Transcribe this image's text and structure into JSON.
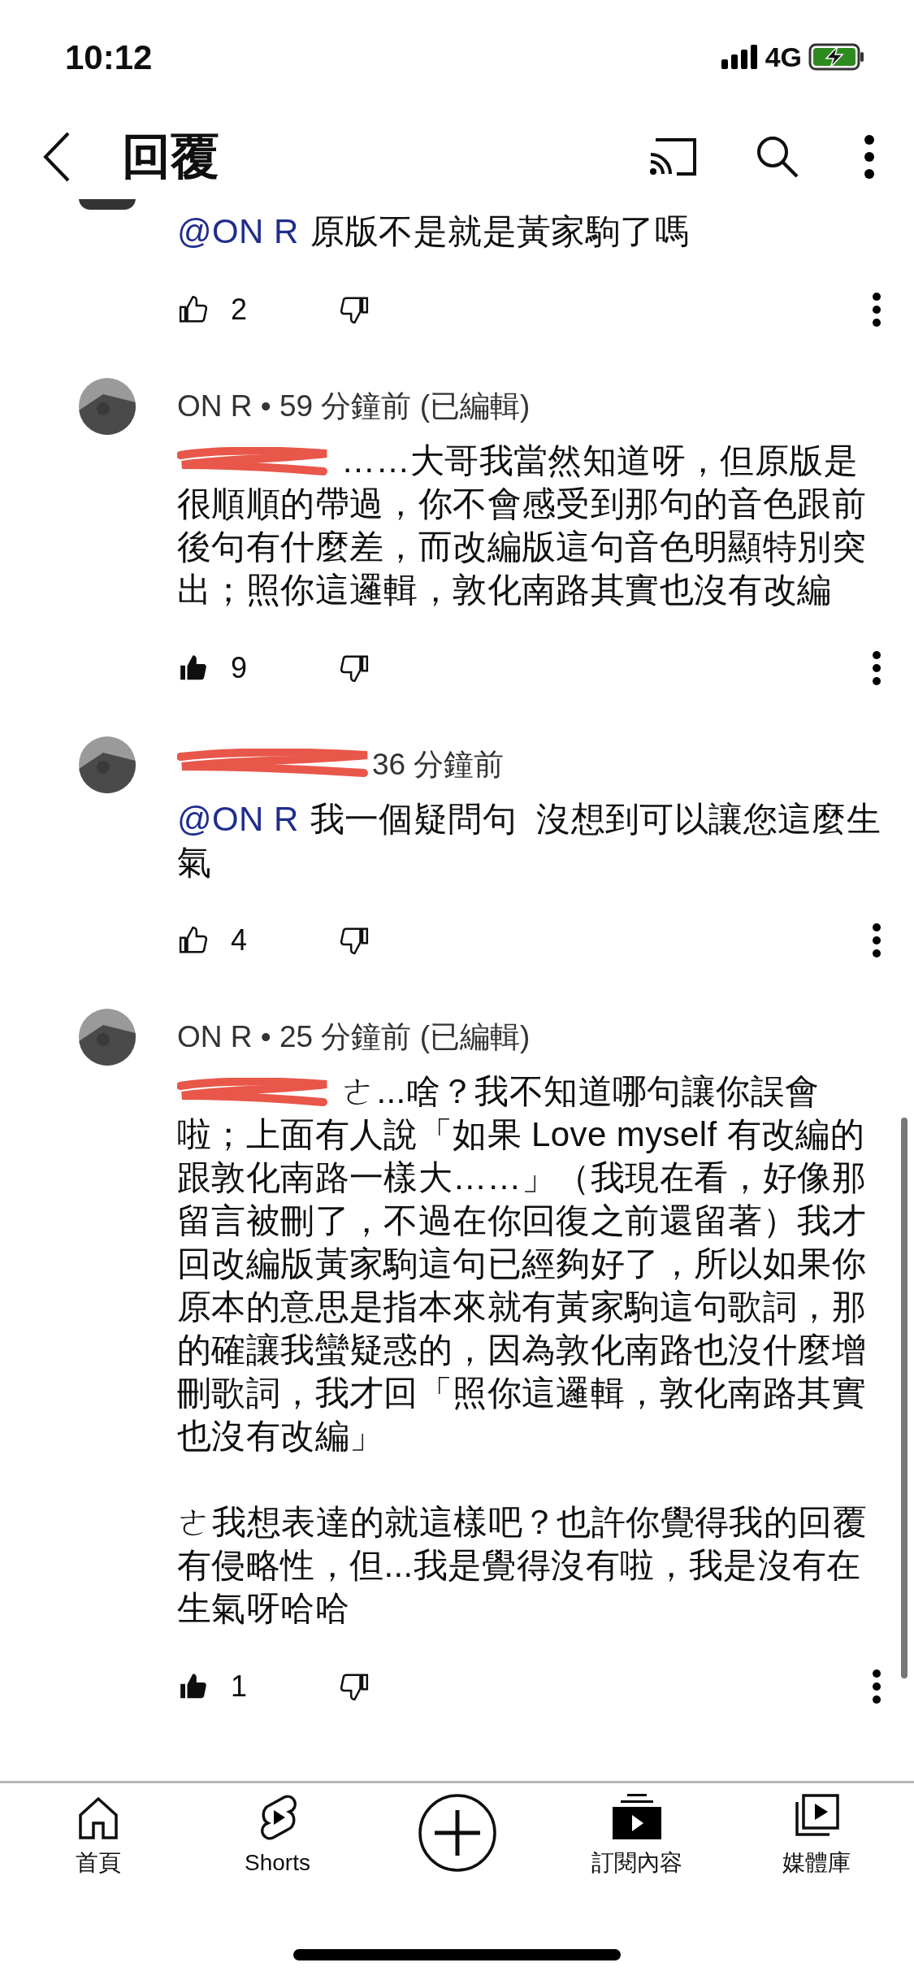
{
  "status_bar": {
    "time": "10:12",
    "network": "4G"
  },
  "header": {
    "title": "回覆"
  },
  "comments": [
    {
      "avatar_clipped": true,
      "mention": "@ON R",
      "paragraphs": [
        "原版不是就是黃家駒了嗎"
      ],
      "likes": "2",
      "liked": false
    },
    {
      "meta": "ON R • 59 分鐘前 (已編輯)",
      "mention_redacted": true,
      "paragraphs": [
        "……大哥我當然知道呀，但原版是很順順的帶過，你不會感受到那句的音色跟前後句有什麼差，而改編版這句音色明顯特別突出；照你這邏輯，敦化南路其實也沒有改編"
      ],
      "likes": "9",
      "liked": true
    },
    {
      "author_redacted": true,
      "meta": "36 分鐘前",
      "mention": "@ON R",
      "paragraphs": [
        "我一個疑問句  沒想到可以讓您這麼生氣"
      ],
      "likes": "4",
      "liked": false
    },
    {
      "meta": "ON R • 25 分鐘前 (已編輯)",
      "mention_redacted": true,
      "paragraphs": [
        "ㄜ...啥？我不知道哪句讓你誤會啦；上面有人說「如果 Love myself 有改編的跟敦化南路一樣大……」（我現在看，好像那留言被刪了，不過在你回復之前還留著）我才回改編版黃家駒這句已經夠好了，所以如果你原本的意思是指本來就有黃家駒這句歌詞，那的確讓我蠻疑惑的，因為敦化南路也沒什麼增刪歌詞，我才回「照你這邏輯，敦化南路其實也沒有改編」",
        "ㄜ我想表達的就這樣吧？也許你覺得我的回覆有侵略性，但...我是覺得沒有啦，我是沒有在生氣呀哈哈"
      ],
      "likes": "1",
      "liked": true
    }
  ],
  "bottom_nav": [
    {
      "kind": "home",
      "label": "首頁"
    },
    {
      "kind": "shorts",
      "label": "Shorts"
    },
    {
      "kind": "create"
    },
    {
      "kind": "subscriptions",
      "label": "訂閱內容"
    },
    {
      "kind": "library",
      "label": "媒體庫"
    }
  ]
}
